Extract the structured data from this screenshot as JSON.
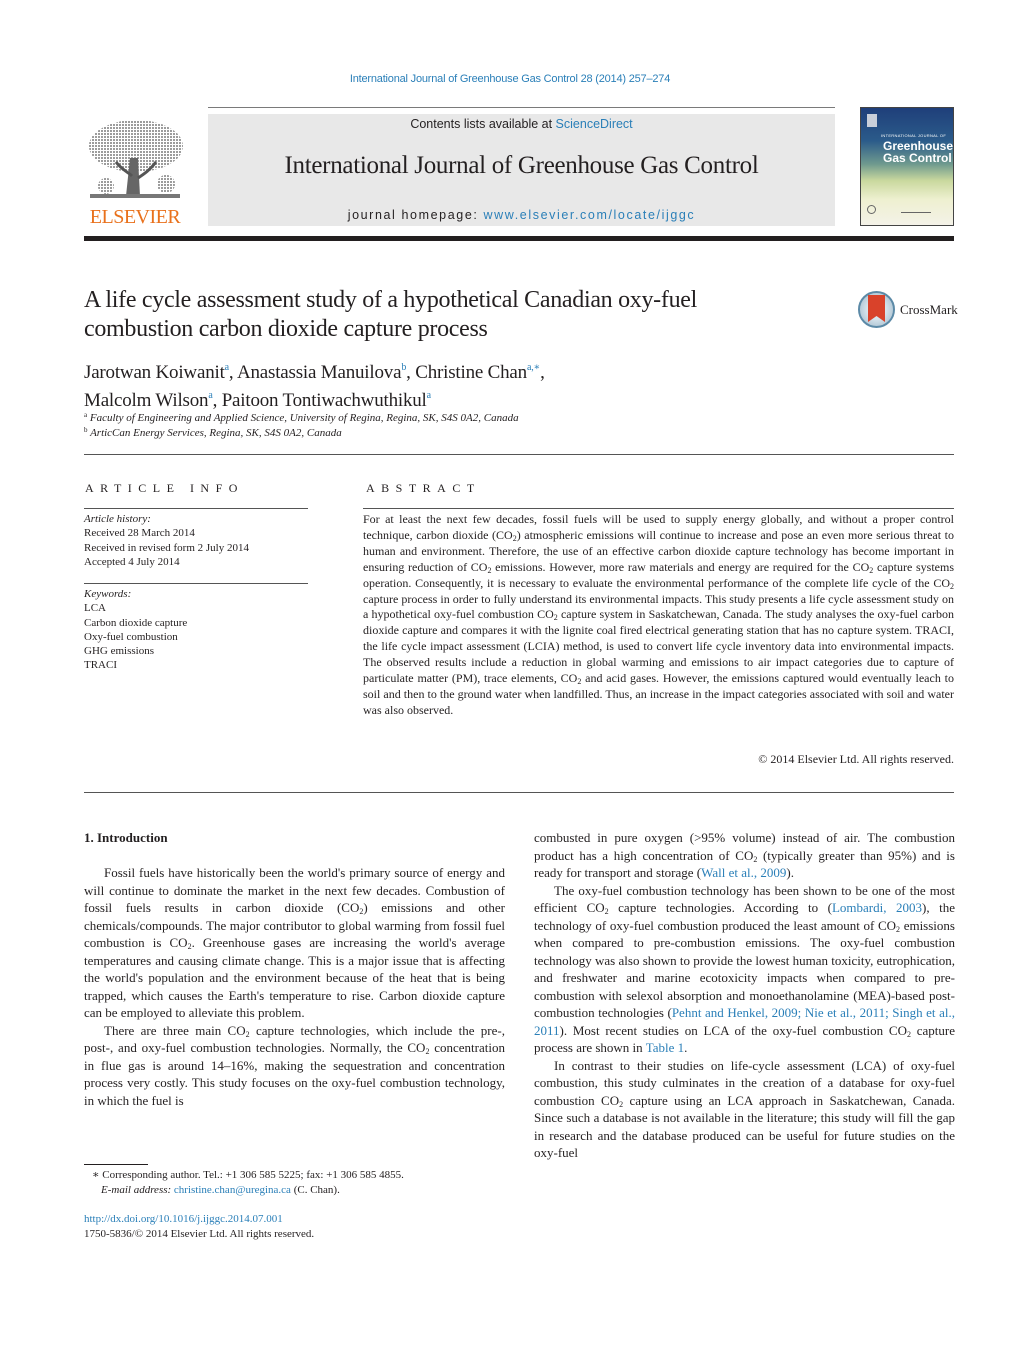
{
  "header": {
    "citation": "International Journal of Greenhouse Gas Control 28 (2014) 257–274",
    "contents_prefix": "Contents lists available at ",
    "contents_link": "ScienceDirect",
    "journal_name": "International Journal of Greenhouse Gas Control",
    "homepage_prefix": "journal homepage: ",
    "homepage_link": "www.elsevier.com/locate/ijggc",
    "publisher_logo_text": "ELSEVIER",
    "cover": {
      "small_text": "INTERNATIONAL JOURNAL OF",
      "title_line1": "Greenhouse",
      "title_line2": "Gas Control"
    }
  },
  "colors": {
    "link": "#2a7fb8",
    "elsevier_orange": "#e9711c",
    "banner_gray": "#e8e8e8",
    "crossmark_red": "#d9422a"
  },
  "article": {
    "title_line1": "A life cycle assessment study of a hypothetical Canadian oxy-fuel",
    "title_line2": "combustion carbon dioxide capture process",
    "crossmark_label": "CrossMark",
    "authors": [
      {
        "name": "Jarotwan Koiwanit",
        "sup": "a",
        "sep": ", "
      },
      {
        "name": "Anastassia Manuilova",
        "sup": "b",
        "sep": ", "
      },
      {
        "name": "Christine Chan",
        "sup": "a,∗",
        "sep": ","
      },
      {
        "name": "Malcolm Wilson",
        "sup": "a",
        "sep": ", "
      },
      {
        "name": "Paitoon Tontiwachwuthikul",
        "sup": "a",
        "sep": ""
      }
    ],
    "affiliations": [
      {
        "mark": "a",
        "text": "Faculty of Engineering and Applied Science, University of Regina, Regina, SK, S4S 0A2, Canada"
      },
      {
        "mark": "b",
        "text": "ArticCan Energy Services, Regina, SK, S4S 0A2, Canada"
      }
    ]
  },
  "article_info": {
    "heading": "ARTICLE INFO",
    "history_label": "Article history:",
    "history": [
      "Received 28 March 2014",
      "Received in revised form 2 July 2014",
      "Accepted 4 July 2014"
    ],
    "keywords_label": "Keywords:",
    "keywords": [
      "LCA",
      "Carbon dioxide capture",
      "Oxy-fuel combustion",
      "GHG emissions",
      "TRACI"
    ]
  },
  "abstract": {
    "heading": "ABSTRACT",
    "segments": [
      "For at least the next few decades, fossil fuels will be used to supply energy globally, and without a proper control technique, carbon dioxide (CO",
      ") atmospheric emissions will continue to increase and pose an even more serious threat to human and environment. Therefore, the use of an effective carbon dioxide capture technology has become important in ensuring reduction of CO",
      " emissions. However, more raw materials and energy are required for the CO",
      " capture systems operation. Consequently, it is necessary to evaluate the environmental performance of the complete life cycle of the CO",
      " capture process in order to fully understand its environmental impacts. This study presents a life cycle assessment study on a hypothetical oxy-fuel combustion CO",
      " capture system in Saskatchewan, Canada. The study analyses the oxy-fuel carbon dioxide capture and compares it with the lignite coal fired electrical generating station that has no capture system. TRACI, the life cycle impact assessment (LCIA) method, is used to convert life cycle inventory data into environmental impacts. The observed results include a reduction in global warming and emissions to air impact categories due to capture of particulate matter (PM), trace elements, CO",
      " and acid gases. However, the emissions captured would eventually leach to soil and then to the ground water when landfilled. Thus, an increase in the impact categories associated with soil and water was also observed."
    ],
    "subscript": "2",
    "copyright": "© 2014 Elsevier Ltd. All rights reserved."
  },
  "intro": {
    "heading": "1.  Introduction",
    "p1": [
      "Fossil fuels have historically been the world's primary source of energy and will continue to dominate the market in the next few decades. Combustion of fossil fuels results in carbon dioxide (CO",
      ") emissions and other chemicals/compounds. The major contributor to global warming from fossil fuel combustion is CO",
      ". Greenhouse gases are increasing the world's average temperatures and causing climate change. This is a major issue that is affecting the world's population and the environment because of the heat that is being trapped, which causes the Earth's temperature to rise. Carbon dioxide capture can be employed to alleviate this problem."
    ],
    "p2": [
      "There are three main CO",
      " capture technologies, which include the pre-, post-, and oxy-fuel combustion technologies. Normally, the CO",
      " concentration in flue gas is around 14–16%, making the sequestration and concentration process very costly. This study focuses on the oxy-fuel combustion technology, in which the fuel is combusted in pure oxygen (>95% volume) instead of air. The combustion product has a high concentration of CO",
      " (typically greater than 95%) and is ready for transport and storage ("
    ],
    "ref_wall": "Wall et al., 2009",
    "p2_end": ").",
    "p3": [
      "The oxy-fuel combustion technology has been shown to be one of the most efficient CO",
      " capture technologies. According to ("
    ],
    "ref_lombardi": "Lombardi, 2003",
    "p3_b": [
      "), the technology of oxy-fuel combustion produced the least amount of CO",
      " emissions when compared to pre-combustion emissions. The oxy-fuel combustion technology was also shown to provide the lowest human toxicity, eutrophication, and freshwater and marine ecotoxicity impacts when compared to pre-combustion with selexol absorption and monoethanolamine (MEA)-based post-combustion technologies ("
    ],
    "ref_pehnt": "Pehnt and Henkel, 2009; Nie et al., 2011; Singh et al., 2011",
    "p3_c": [
      "). Most recent studies on LCA of the oxy-fuel combustion CO",
      " capture process are shown in "
    ],
    "ref_table": "Table 1",
    "p3_end": ".",
    "p4": [
      "In contrast to their studies on life-cycle assessment (LCA) of oxy-fuel combustion, this study culminates in the creation of a database for oxy-fuel combustion CO",
      " capture using an LCA approach in Saskatchewan, Canada. Since such a database is not available in the literature; this study will fill the gap in research and the database produced can be useful for future studies on the oxy-fuel"
    ]
  },
  "footnote": {
    "mark": "∗",
    "corresponding": " Corresponding author. Tel.: +1 306 585 5225; fax: +1 306 585 4855.",
    "email_label": "E-mail address: ",
    "email": "christine.chan@uregina.ca",
    "email_suffix": " (C. Chan).",
    "doi": "http://dx.doi.org/10.1016/j.ijggc.2014.07.001",
    "issn": "1750-5836/© 2014 Elsevier Ltd. All rights reserved."
  }
}
